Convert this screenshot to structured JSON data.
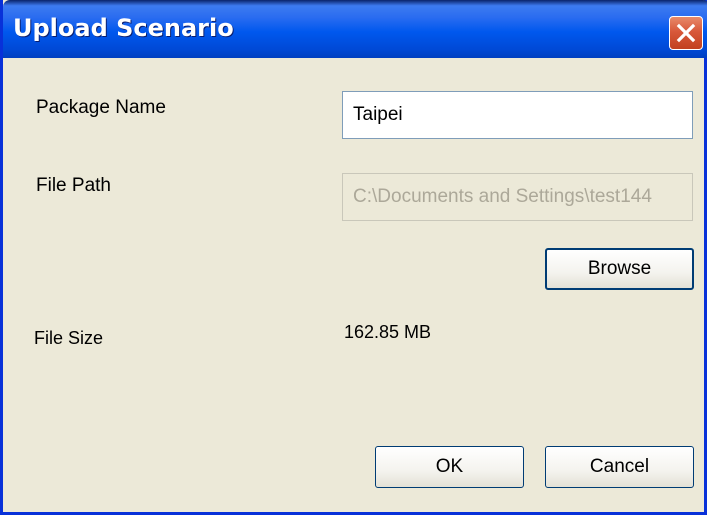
{
  "dialog": {
    "title": "Upload Scenario"
  },
  "form": {
    "package_name_label": "Package Name",
    "package_name_value": "Taipei",
    "file_path_label": "File Path",
    "file_path_value": "C:\\Documents and Settings\\test144",
    "file_size_label": "File Size",
    "file_size_value": "162.85 MB"
  },
  "buttons": {
    "browse": "Browse",
    "ok": "OK",
    "cancel": "Cancel"
  },
  "icons": {
    "close": "close-icon"
  },
  "colors": {
    "titlebar": "#0058ee",
    "dialog_bg": "#ece9d8",
    "close_button": "#d8583a",
    "disabled_text": "#aca899"
  }
}
